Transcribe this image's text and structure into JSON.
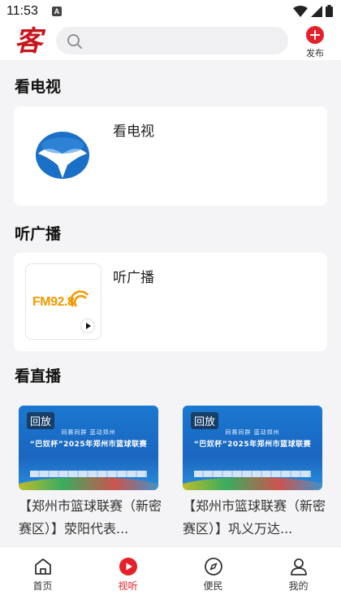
{
  "status_bar": {
    "time": "11:53",
    "notification_glyph": "A"
  },
  "header": {
    "logo_char": "客",
    "search_icon": "search-icon",
    "publish_label": "发布"
  },
  "sections": {
    "tv": {
      "title": "看电视",
      "card_title": "看电视"
    },
    "radio": {
      "title": "听广播",
      "card_title": "听广播",
      "logo_text": "FM92.8"
    },
    "live": {
      "title": "看直播",
      "items": [
        {
          "badge": "回放",
          "banner_sub": "同赛同群 蓝动郑州",
          "banner_main": "“巴奴杯”2025年郑州市篮球联赛",
          "title": "【郑州市篮球联赛（新密赛区）】荥阳代表..."
        },
        {
          "badge": "回放",
          "banner_sub": "同赛同群 蓝动郑州",
          "banner_main": "“巴奴杯”2025年郑州市篮球联赛",
          "title": "【郑州市篮球联赛（新密赛区）】巩义万达..."
        }
      ]
    }
  },
  "tabbar": {
    "items": [
      {
        "label": "首页",
        "icon": "home-icon",
        "active": false
      },
      {
        "label": "视听",
        "icon": "play-circle-icon",
        "active": true
      },
      {
        "label": "便民",
        "icon": "compass-icon",
        "active": false
      },
      {
        "label": "我的",
        "icon": "user-icon",
        "active": false
      }
    ]
  },
  "colors": {
    "accent": "#e5202a",
    "background": "#f4f4f6",
    "card": "#ffffff",
    "fm_orange": "#f39800"
  }
}
